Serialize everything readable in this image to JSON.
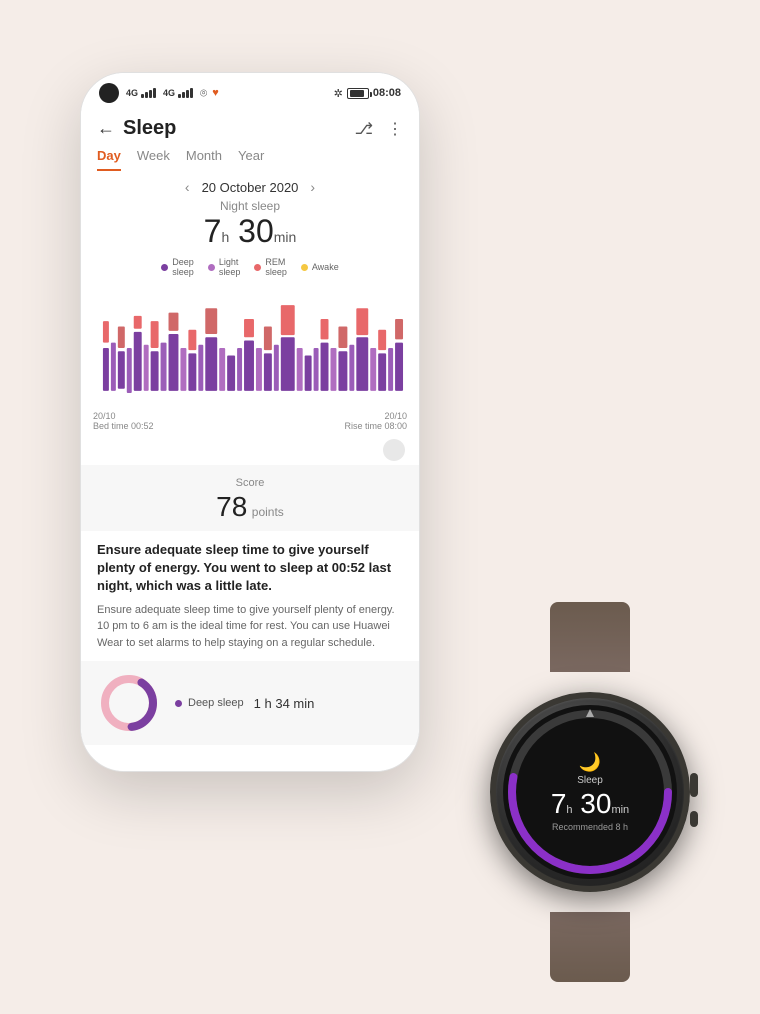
{
  "statusBar": {
    "time": "08:08",
    "signal1": "4G",
    "signal2": "4G",
    "bluetooth": "✲",
    "wifi": "wifi"
  },
  "header": {
    "title": "Sleep",
    "backLabel": "←"
  },
  "tabs": {
    "items": [
      "Day",
      "Week",
      "Month",
      "Year"
    ],
    "active": "Day"
  },
  "dateNav": {
    "date": "20 October 2020",
    "prevArrow": "‹",
    "nextArrow": "›"
  },
  "sleepSummary": {
    "nightSleepLabel": "Night sleep",
    "hours": "7",
    "hoursUnit": "h",
    "minutes": "30",
    "minutesUnit": "min"
  },
  "legend": {
    "items": [
      {
        "label": "Deep\nsleep",
        "color": "#7b3fa0"
      },
      {
        "label": "Light\nsleep",
        "color": "#b06dc0"
      },
      {
        "label": "REM\nsleep",
        "color": "#e8686a"
      },
      {
        "label": "Awake",
        "color": "#f5c842"
      }
    ]
  },
  "chartLabels": {
    "left": "20/10\nBed time 00:52",
    "right": "20/10\nRise time 08:00"
  },
  "score": {
    "label": "Score",
    "value": "78",
    "unit": "points"
  },
  "summaryText": {
    "bold": "Ensure adequate sleep time to give yourself plenty of energy. You went to sleep at 00:52 last night, which was a little late.",
    "regular": "Ensure adequate sleep time to give yourself plenty of energy. 10 pm to 6 am is the ideal time for rest. You can use Huawei Wear to set alarms to help staying on a regular schedule."
  },
  "donut": {
    "label": "Deep sleep",
    "color": "#7b3fa0",
    "duration": "1 h 34 min",
    "pinkColor": "#f0a0b0"
  },
  "watch": {
    "sleepLabel": "Sleep",
    "time": "7",
    "timeH": "h",
    "timeMin": "30",
    "timeMinUnit": "min",
    "recommended": "Recommended 8 h",
    "ringColor": "#8b30c8",
    "ringBg": "#3a3a3a"
  }
}
